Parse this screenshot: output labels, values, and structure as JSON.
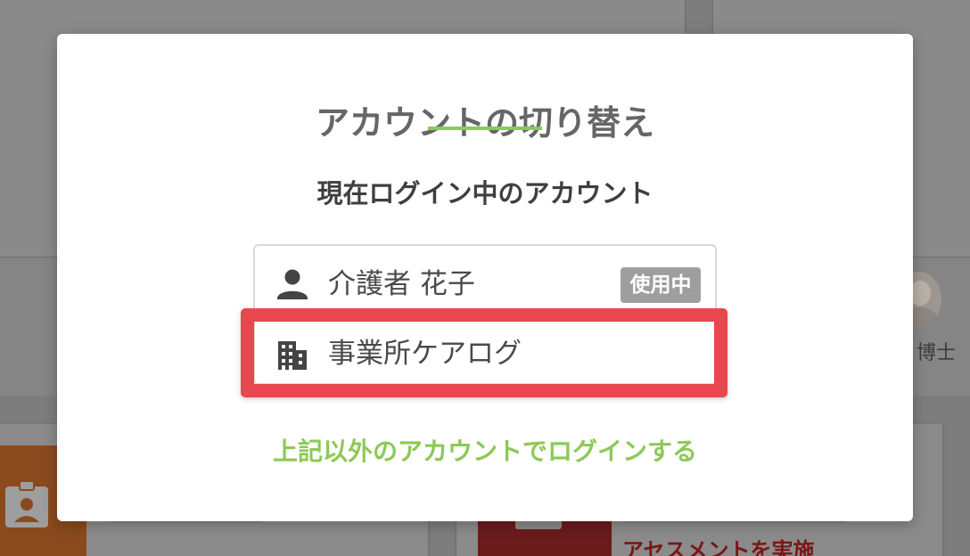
{
  "modal": {
    "title": "アカウントの切り替え",
    "section_heading": "現在ログイン中のアカウント",
    "accounts": [
      {
        "icon": "person-icon",
        "label": "介護者 花子",
        "badge": "使用中"
      },
      {
        "icon": "building-icon",
        "label": "事業所ケアログ"
      }
    ],
    "other_login_link": "上記以外のアカウントでログインする",
    "accent_color": "#8dc957",
    "highlight_color": "#e8474e"
  },
  "background": {
    "user_name_partial": "博士",
    "card_text_partial": "アセスメントを実施"
  }
}
